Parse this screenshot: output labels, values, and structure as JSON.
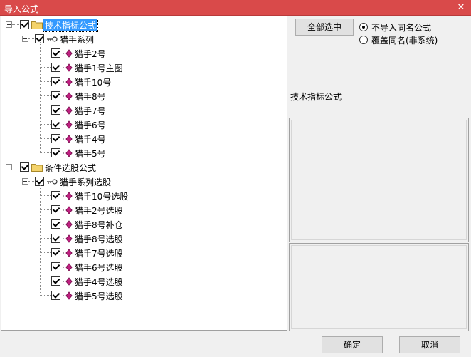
{
  "window": {
    "title": "导入公式",
    "close_glyph": "✕"
  },
  "tree": {
    "groups": [
      {
        "label": "技术指标公式",
        "subgroup": {
          "label": "猎手系列",
          "items": [
            "猎手2号",
            "猎手1号主图",
            "猎手10号",
            "猎手8号",
            "猎手7号",
            "猎手6号",
            "猎手4号",
            "猎手5号"
          ]
        }
      },
      {
        "label": "条件选股公式",
        "subgroup": {
          "label": "猎手系列选股",
          "items": [
            "猎手10号选股",
            "猎手2号选股",
            "猎手8号补仓",
            "猎手8号选股",
            "猎手7号选股",
            "猎手6号选股",
            "猎手4号选股",
            "猎手5号选股"
          ]
        }
      }
    ]
  },
  "controls": {
    "select_all_label": "全部选中",
    "radio_options": [
      {
        "label": "不导入同名公式",
        "selected": true
      },
      {
        "label": "覆盖同名(非系统)",
        "selected": false
      }
    ],
    "info_label": "技术指标公式"
  },
  "footer": {
    "ok_label": "确定",
    "cancel_label": "取消"
  },
  "colors": {
    "titlebar": "#d94a4a",
    "selection": "#3399ff",
    "item_icon": "#c02080"
  },
  "icons": {
    "folder": "folder-icon",
    "series": "key-series-icon",
    "formula": "formula-diamond-icon",
    "expander": "collapse-minus-icon",
    "close": "close-icon"
  }
}
